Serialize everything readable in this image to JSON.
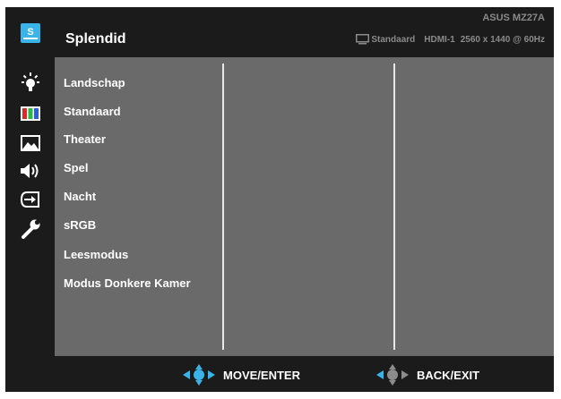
{
  "colors": {
    "accent": "#3ab4e8",
    "panel": "#6a6a6a",
    "bar": "#1b1b1b",
    "text": "#ffffff",
    "status_text": "#8a8a8a"
  },
  "sidebar": {
    "items": [
      {
        "icon": "splendid-icon",
        "label": "S",
        "selected": true
      },
      {
        "icon": "brightness-icon"
      },
      {
        "icon": "color-icon"
      },
      {
        "icon": "image-icon"
      },
      {
        "icon": "sound-icon"
      },
      {
        "icon": "input-select-icon"
      },
      {
        "icon": "system-setup-icon"
      }
    ]
  },
  "header": {
    "title": "Splendid",
    "model": "ASUS MZ27A",
    "status": {
      "preset": "Standaard",
      "input": "HDMI-1",
      "resolution": "2560 x 1440 @ 60Hz"
    }
  },
  "menu": {
    "items": [
      "Landschap",
      "Standaard",
      "Theater",
      "Spel",
      "Nacht",
      "sRGB",
      "Leesmodus",
      "Modus Donkere Kamer"
    ]
  },
  "footer": {
    "move_label": "MOVE/ENTER",
    "back_label": "BACK/EXIT"
  }
}
